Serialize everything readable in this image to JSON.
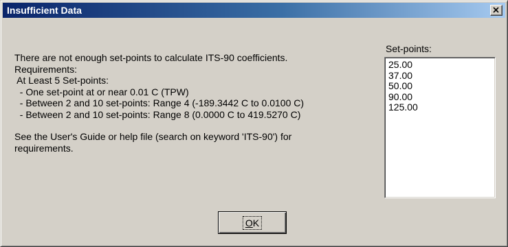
{
  "window": {
    "title": "Insufficient Data"
  },
  "icons": {
    "close": "close-icon"
  },
  "message": {
    "lines": [
      "There are not enough set-points to calculate ITS-90 coefficients.",
      "Requirements:",
      " At Least 5 Set-points:",
      "  - One set-point at or near 0.01 C (TPW)",
      "  - Between 2 and 10 set-points: Range 4 (-189.3442 C to 0.0100 C)",
      "  - Between 2 and 10 set-points: Range 8 (0.0000 C to 419.5270 C)"
    ],
    "footer_lines": [
      "See the User's Guide or help file (search on keyword 'ITS-90') for",
      "requirements."
    ]
  },
  "setpoints": {
    "label": "Set-points:",
    "items": [
      "25.00",
      "37.00",
      "50.00",
      "90.00",
      "125.00"
    ]
  },
  "buttons": {
    "ok_accel": "O",
    "ok_rest": "K"
  },
  "colors": {
    "title_start": "#0a246a",
    "title_end": "#a6caf0",
    "face": "#d4d0c8"
  }
}
